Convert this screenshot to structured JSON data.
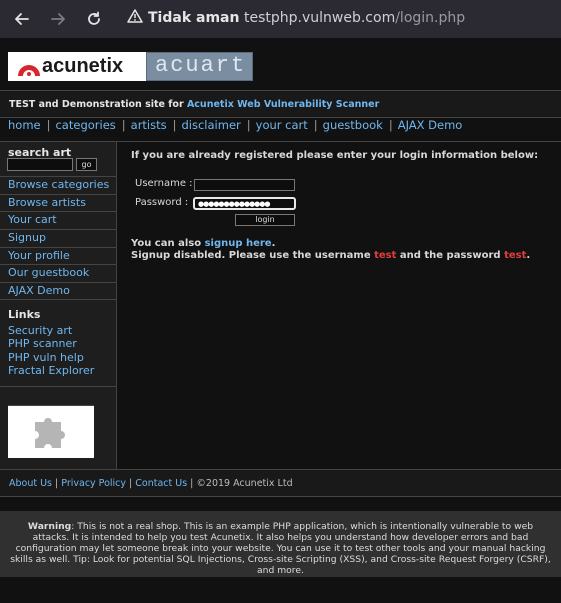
{
  "browser": {
    "back_icon": "arrow-left-icon",
    "forward_icon": "arrow-right-icon",
    "reload_icon": "reload-icon",
    "security_label": "Tidak aman",
    "url_host": "testphp.vulnweb.com",
    "url_path": "/login.php"
  },
  "site": {
    "logo_left": "acunetix",
    "logo_right": "acuart",
    "tagline_prefix": "TEST and Demonstration site for ",
    "tagline_link": "Acunetix Web Vulnerability Scanner",
    "nav": [
      "home",
      "categories",
      "artists",
      "disclaimer",
      "your cart",
      "guestbook",
      "AJAX Demo"
    ]
  },
  "sidebar": {
    "search_title": "search art",
    "search_value": "",
    "go_label": "go",
    "items": [
      "Browse categories",
      "Browse artists",
      "Your cart",
      "Signup",
      "Your profile",
      "Our guestbook",
      "AJAX Demo"
    ],
    "links_title": "Links",
    "links": [
      "Security art",
      "PHP scanner",
      "PHP vuln help",
      "Fractal Explorer"
    ],
    "plugin_icon": "puzzle-piece-icon"
  },
  "login": {
    "intro": "If you are already registered please enter your login information below:",
    "username_label": "Username :",
    "password_label": "Password :",
    "username_value": "",
    "password_mask": "●●●●●●●●●●●●●●",
    "button_label": "login",
    "also_prefix": "You can also ",
    "signup_link": "signup here",
    "also_suffix": ".",
    "disabled_a": "Signup disabled. Please use the username ",
    "disabled_user": "test",
    "disabled_b": " and the password ",
    "disabled_pass": "test",
    "disabled_c": "."
  },
  "footer": {
    "about": "About Us",
    "privacy": "Privacy Policy",
    "contact": "Contact Us",
    "copyright": "©2019 Acunetix Ltd"
  },
  "warning": {
    "bold": "Warning",
    "text": ": This is not a real shop. This is an example PHP application, which is intentionally vulnerable to web attacks. It is intended to help you test Acunetix. It also helps you understand how developer errors and bad configuration may let someone break into your website. You can use it to test other tools and your manual hacking skills as well. Tip: Look for potential SQL Injections, Cross-site Scripting (XSS), and Cross-site Request Forgery (CSRF), and more."
  },
  "colors": {
    "link": "#6fb7f0",
    "highlight_red": "#e53c3c",
    "background": "#111111"
  }
}
